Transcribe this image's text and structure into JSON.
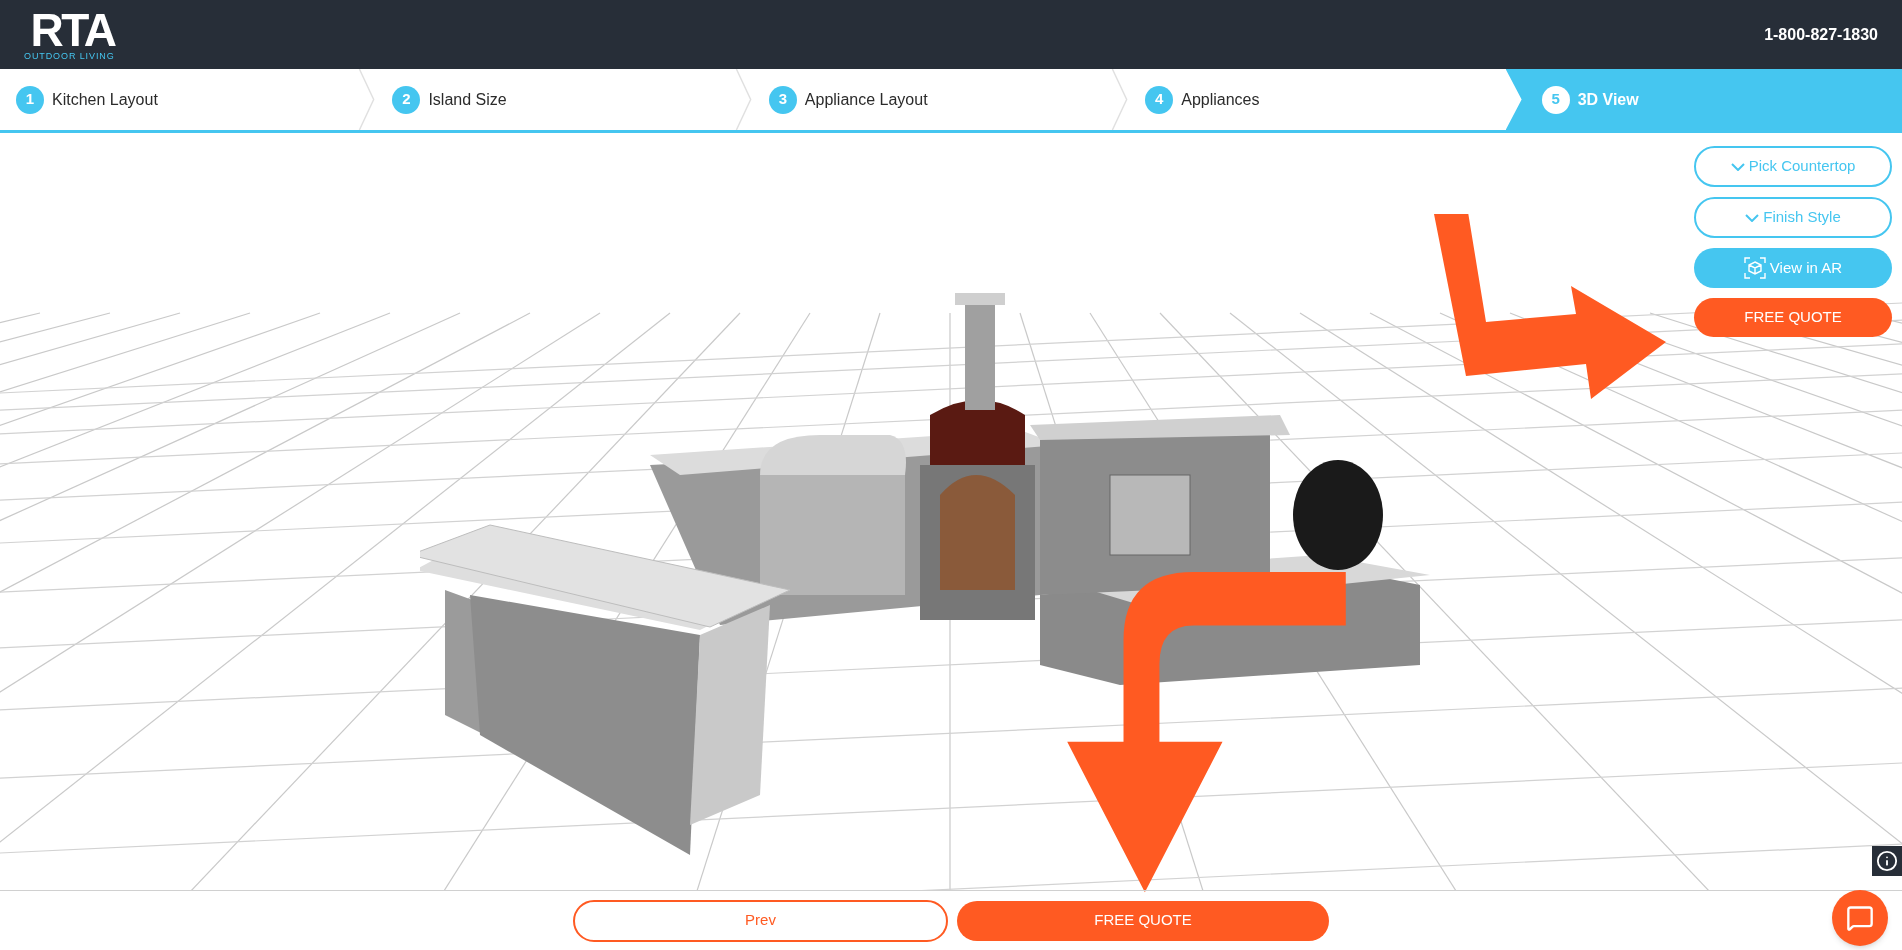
{
  "header": {
    "logo": "RTA",
    "logo_tagline": "OUTDOOR LIVING",
    "phone": "1-800-827-1830"
  },
  "steps": [
    {
      "number": "1",
      "label": "Kitchen Layout",
      "selected": false
    },
    {
      "number": "2",
      "label": "Island Size",
      "selected": false
    },
    {
      "number": "3",
      "label": "Appliance Layout",
      "selected": false
    },
    {
      "number": "4",
      "label": "Appliances",
      "selected": false
    },
    {
      "number": "5",
      "label": "3D View",
      "selected": true
    }
  ],
  "side_buttons": [
    {
      "kind": "dropdown",
      "label": "Pick Countertop"
    },
    {
      "kind": "dropdown",
      "label": "Finish Style"
    },
    {
      "kind": "ar",
      "label": "View in AR"
    },
    {
      "kind": "quote",
      "label": "FREE QUOTE"
    }
  ],
  "bottom_buttons": [
    {
      "kind": "outline",
      "label": "Prev"
    },
    {
      "kind": "quote",
      "label": "FREE QUOTE"
    }
  ]
}
